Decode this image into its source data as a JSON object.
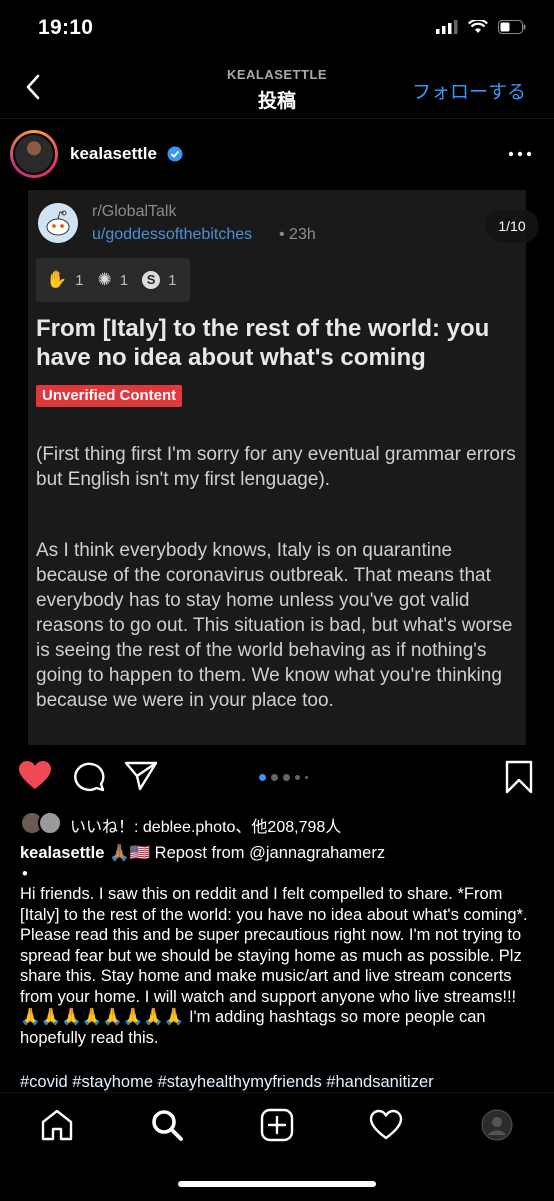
{
  "status": {
    "time": "19:10"
  },
  "nav": {
    "subtitle": "KEALASETTLE",
    "title": "投稿",
    "follow": "フォローする"
  },
  "post": {
    "username": "kealasettle",
    "counter": "1/10",
    "reddit": {
      "subreddit": "r/GlobalTalk",
      "user": "u/goddessofthebitches",
      "time": "• 23h",
      "awards": [
        "1",
        "1",
        "1"
      ],
      "heading": "From [Italy] to the rest of the world: you have no idea about what's coming",
      "badge": "Unverified Content",
      "para1": "(First thing first I'm sorry for any eventual grammar errors but English isn't my first lenguage).",
      "para2": "As I think everybody knows, Italy is on quarantine because of the coronavirus outbreak. That means that everybody has to stay home unless you've got valid reasons to go out. This situation is bad, but what's worse is seeing the rest of the world behaving as if nothing's going to happen to them. We know what you're thinking because we were in your place too."
    },
    "likes": "いいね！: deblee.photo、他208,798人",
    "caption": {
      "user": "kealasettle",
      "line1_rest": " 🙏🏽🇺🇸 Repost from @jannagrahamerz",
      "bullet": "•",
      "body": "Hi friends. I saw this on reddit and I felt compelled to share. *From [Italy] to the rest of the world: you have no idea about what's coming*. Please read this and be super precautious right now. I'm not trying to spread fear but we should be staying home as much as possible. Plz share this. Stay home and make music/art and live stream concerts from your home. I will watch and support anyone who live streams!!! 🙏🙏🙏🙏🙏🙏🙏🙏 I'm adding hashtags so more people can hopefully read this.",
      "hashtags": "#covid #stayhome #stayhealthymyfriends #handsanitizer"
    }
  },
  "colors": {
    "accent": "#3c95f6",
    "like": "#ed4956",
    "badge": "#e0383b",
    "link": "#4a90d9"
  },
  "icons": [
    "back-icon",
    "verified-icon",
    "more-icon",
    "heart-icon",
    "comment-icon",
    "share-icon",
    "bookmark-icon",
    "home-icon",
    "search-icon",
    "add-icon",
    "activity-icon",
    "profile-icon"
  ]
}
